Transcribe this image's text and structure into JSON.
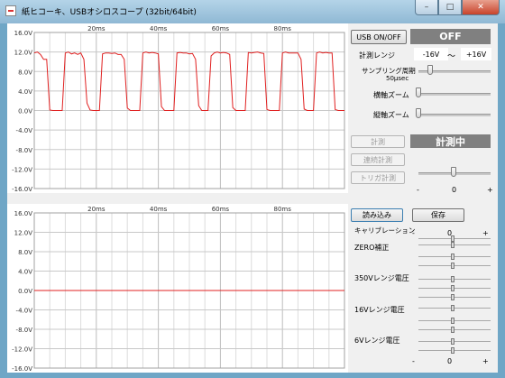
{
  "window": {
    "title": "紙ヒコーキ、USBオシロスコープ (32bit/64bit)",
    "controls": {
      "minimize": "–",
      "maximize": "□",
      "close": "✕"
    }
  },
  "scope_top": {
    "y_ticks": [
      "16.0V",
      "12.0V",
      "8.0V",
      "4.0V",
      "0.0V",
      "-4.0V",
      "-8.0V",
      "-12.0V",
      "-16.0V"
    ],
    "x_ticks": [
      "20ms",
      "40ms",
      "60ms",
      "80ms"
    ]
  },
  "scope_bottom": {
    "y_ticks": [
      "16.0V",
      "12.0V",
      "8.0V",
      "4.0V",
      "0.0V",
      "-4.0V",
      "-8.0V",
      "-12.0V",
      "-16.0V"
    ],
    "x_ticks": [
      "20ms",
      "40ms",
      "60ms",
      "80ms"
    ]
  },
  "chart_data": [
    {
      "type": "line",
      "xlabel": "",
      "ylabel": "",
      "x_ticks": [
        "20ms",
        "40ms",
        "60ms",
        "80ms"
      ],
      "ylim": [
        -16,
        16
      ],
      "grid": true,
      "series": [
        {
          "color": "#e02020",
          "x": [
            0,
            1,
            2,
            3,
            4,
            5,
            6,
            7,
            8,
            9,
            10,
            11,
            12,
            13,
            14,
            15,
            16,
            17,
            18,
            19,
            20,
            21,
            22,
            23,
            24,
            25,
            26,
            27,
            28,
            29,
            30,
            31,
            32,
            33,
            34,
            35,
            36,
            37,
            38,
            39,
            40,
            41,
            42,
            43,
            44,
            45,
            46,
            47,
            48,
            49,
            50,
            51,
            52,
            53,
            54,
            55,
            56,
            57,
            58,
            59,
            60,
            61,
            62,
            63,
            64,
            65,
            66,
            67,
            68,
            69,
            70,
            71,
            72,
            73,
            74,
            75,
            76,
            77,
            78,
            79,
            80,
            81,
            82,
            83,
            84,
            85,
            86,
            87,
            88,
            89,
            90,
            91,
            92,
            93,
            94,
            95,
            96,
            97,
            98,
            99,
            100
          ],
          "values": [
            11.8,
            12.0,
            11.5,
            10.5,
            10.5,
            0.1,
            0.0,
            0.0,
            0.0,
            0.0,
            11.8,
            12.0,
            11.6,
            11.8,
            11.5,
            11.8,
            10.5,
            1.5,
            0.1,
            0.0,
            0.0,
            0.0,
            11.6,
            11.8,
            11.8,
            11.7,
            11.8,
            11.5,
            11.5,
            10.5,
            0.5,
            0.0,
            0.0,
            0.0,
            0.0,
            11.8,
            12.0,
            11.8,
            11.9,
            11.8,
            11.6,
            0.8,
            0.0,
            0.0,
            0.0,
            0.0,
            11.8,
            11.9,
            11.8,
            11.8,
            11.6,
            11.7,
            10.5,
            1.0,
            0.0,
            0.0,
            0.0,
            11.2,
            11.8,
            12.0,
            11.8,
            11.9,
            11.8,
            11.5,
            0.6,
            0.0,
            0.0,
            0.0,
            0.0,
            11.9,
            11.8,
            11.9,
            12.0,
            11.8,
            11.7,
            0.2,
            0.0,
            0.0,
            0.0,
            0.0,
            11.8,
            12.0,
            11.8,
            11.8,
            11.8,
            11.8,
            10.5,
            0.3,
            0.0,
            0.0,
            0.0,
            11.8,
            12.0,
            11.8,
            11.9,
            11.8,
            11.8,
            0.2,
            0.0,
            0.0,
            0.0
          ]
        }
      ]
    },
    {
      "type": "line",
      "xlabel": "",
      "ylabel": "",
      "x_ticks": [
        "20ms",
        "40ms",
        "60ms",
        "80ms"
      ],
      "ylim": [
        -16,
        16
      ],
      "grid": true,
      "series": [
        {
          "color": "#e02020",
          "x": [
            0,
            100
          ],
          "values": [
            0.0,
            0.0
          ]
        }
      ]
    }
  ],
  "controls": {
    "usb_button": "USB ON/OFF",
    "usb_state": "OFF",
    "range_label": "計測レンジ",
    "range_min": "-16V",
    "range_sep": "〜",
    "range_max": "+16V",
    "sampling_label": "サンプリング周期",
    "sampling_value": "50μsec",
    "h_zoom_label": "横軸ズーム",
    "v_zoom_label": "縦軸ズーム",
    "measure_button": "計測",
    "measure_state": "計測中",
    "continuous_button": "連続計測",
    "trigger_button": "トリガ計測",
    "trigger_min": "-",
    "trigger_mid": "0",
    "trigger_max": "+",
    "read_button": "読み込み",
    "save_button": "保存",
    "calibration_label": "キャリブレーション",
    "cal_minus": "-",
    "cal_zero": "0",
    "cal_plus": "+",
    "zero_label": "ZERO補正",
    "r350_label": "350Vレンジ電圧",
    "r16_label": "16Vレンジ電圧",
    "r6_label": "6Vレンジ電圧",
    "bottom_minus": "-",
    "bottom_zero": "0",
    "bottom_plus": "+"
  }
}
